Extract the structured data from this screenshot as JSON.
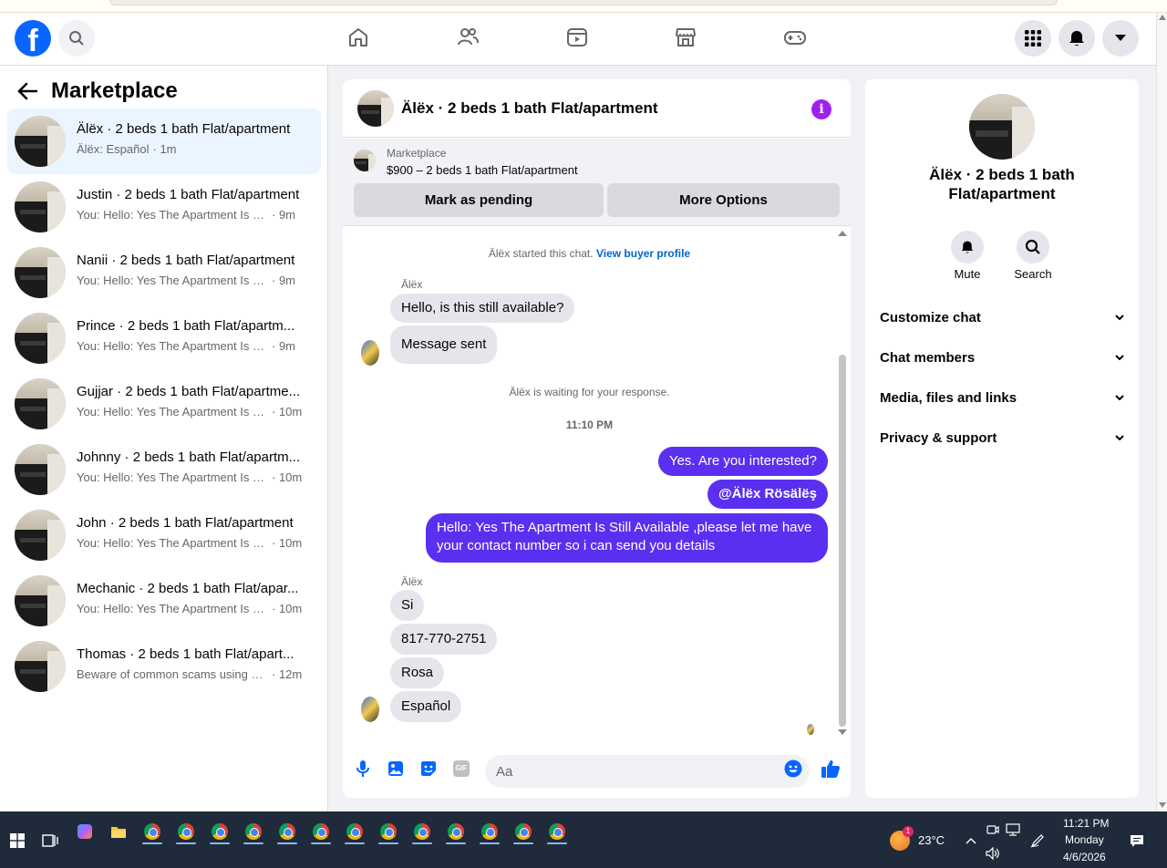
{
  "colors": {
    "fb_blue": "#0866ff",
    "outgoing_bubble": "#5b2ff0",
    "link_blue": "#0064d1",
    "info_purple": "#a020f0"
  },
  "topnav": {
    "logo_icon": "facebook-logo",
    "icons": [
      "search-icon",
      "home-icon",
      "friends-icon",
      "video-icon",
      "marketplace-icon",
      "gaming-icon",
      "menu-grid-icon",
      "bell-icon",
      "account-caret-icon"
    ]
  },
  "sidebar": {
    "title": "Marketplace",
    "conversations": [
      {
        "name": "Älëx · 2 beds 1 bath Flat/apartment",
        "preview": "Älëx: Español",
        "time": "· 1m",
        "active": true
      },
      {
        "name": "Justin · 2 beds 1 bath Flat/apartment",
        "preview": "You: Hello: Yes The Apartment Is Still ...",
        "time": "· 9m"
      },
      {
        "name": "Nanii · 2 beds 1 bath Flat/apartment",
        "preview": "You: Hello: Yes The Apartment Is Still ...",
        "time": "· 9m"
      },
      {
        "name": "Prince · 2 beds 1 bath Flat/apartm...",
        "preview": "You: Hello: Yes The Apartment Is Still ...",
        "time": "· 9m"
      },
      {
        "name": "Gujjar · 2 beds 1 bath Flat/apartme...",
        "preview": "You: Hello: Yes The Apartment Is Still...",
        "time": "· 10m"
      },
      {
        "name": "Johnny · 2 beds 1 bath Flat/apartm...",
        "preview": "You: Hello: Yes The Apartment Is Still...",
        "time": "· 10m"
      },
      {
        "name": "John · 2 beds 1 bath Flat/apartment",
        "preview": "You: Hello: Yes The Apartment Is Still...",
        "time": "· 10m"
      },
      {
        "name": "Mechanic · 2 beds 1 bath Flat/apar...",
        "preview": "You: Hello: Yes The Apartment Is Still...",
        "time": "· 10m"
      },
      {
        "name": "Thomas · 2 beds 1 bath Flat/apart...",
        "preview": "Beware of common scams using pa...",
        "time": "· 12m"
      }
    ]
  },
  "chat": {
    "title": "Älëx · 2 beds 1 bath Flat/apartment",
    "info_glyph": "i",
    "listing": {
      "label": "Marketplace",
      "price_line": "$900 – 2 beds 1 bath Flat/apartment"
    },
    "buttons": {
      "pending": "Mark as pending",
      "more": "More Options"
    },
    "started_text": "Älëx started this chat.",
    "started_link": "View buyer profile",
    "sender_1": "Älëx",
    "msg_in_1": "Hello, is this still available?",
    "msg_in_2": "Message sent",
    "waiting_text": "Älëx is waiting for your response.",
    "timestamp": "11:10 PM",
    "msg_out_1": "Yes. Are you interested?",
    "msg_out_2": "@Älëx Rösälëş",
    "msg_out_3_line1": "Hello: Yes The Apartment Is Still Available ,please let me have",
    "msg_out_3_line2": "your contact number so i can send you details",
    "sender_2": "Älëx",
    "msg_in_3": "Si",
    "msg_in_4": "817-770-2751",
    "msg_in_5": "Rosa",
    "msg_in_6": "Español",
    "composer_placeholder": "Aa",
    "composer_icons": [
      "microphone-icon",
      "photo-icon",
      "sticker-icon",
      "gif-icon",
      "emoji-icon",
      "thumbs-up-icon"
    ],
    "gif_label": "GIF"
  },
  "info_panel": {
    "title": "Älëx · 2 beds 1 bath Flat/apartment",
    "actions": {
      "mute": "Mute",
      "search": "Search"
    },
    "sections": [
      "Customize chat",
      "Chat members",
      "Media, files and links",
      "Privacy & support"
    ]
  },
  "taskbar": {
    "weather": "23°C",
    "time": "11:21 PM",
    "day": "Monday",
    "date": "4/6/2026",
    "weather_badge": "1"
  }
}
